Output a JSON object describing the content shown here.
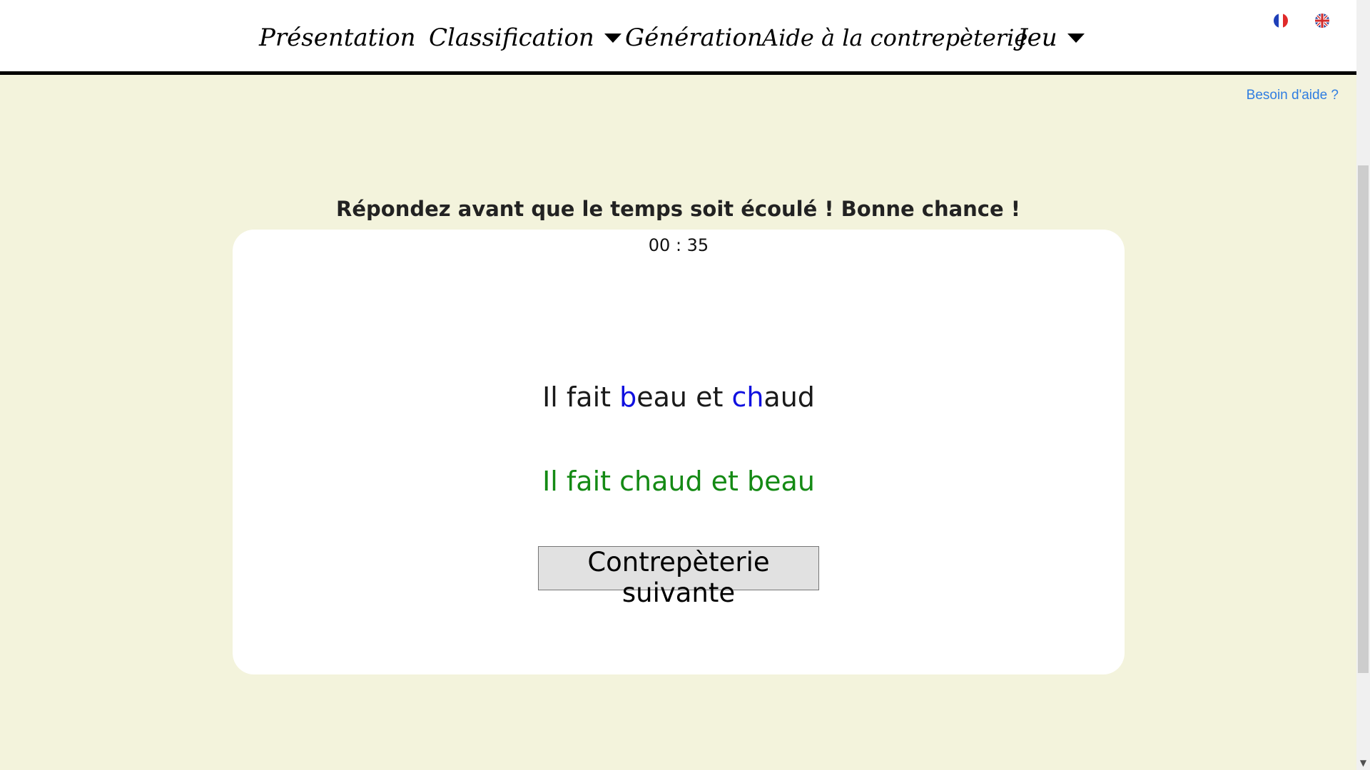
{
  "nav": {
    "items": [
      {
        "label": "Présentation",
        "has_dropdown": false
      },
      {
        "label": "Classification",
        "has_dropdown": true
      },
      {
        "label": "Génération",
        "has_dropdown": false
      },
      {
        "label": "Aide à la contrepèterie",
        "has_dropdown": false
      },
      {
        "label": "Jeu",
        "has_dropdown": true
      }
    ],
    "flags": [
      {
        "icon": "french-flag-icon"
      },
      {
        "icon": "uk-flag-icon"
      }
    ]
  },
  "help_link": "Besoin d'aide ?",
  "instruction": "Répondez avant que le temps soit écoulé ! Bonne chance !",
  "card": {
    "timer": "00 : 35",
    "original_phrase": {
      "segments": [
        "Il fait ",
        "b",
        "eau et ",
        "ch",
        "aud"
      ],
      "highlight_color": "#1010e0"
    },
    "answer_phrase": "Il fait chaud et beau",
    "answer_color": "#148a14",
    "next_button": "Contrepèterie suivante"
  },
  "colors": {
    "background": "#f3f3dc",
    "link": "#2f7de1"
  }
}
